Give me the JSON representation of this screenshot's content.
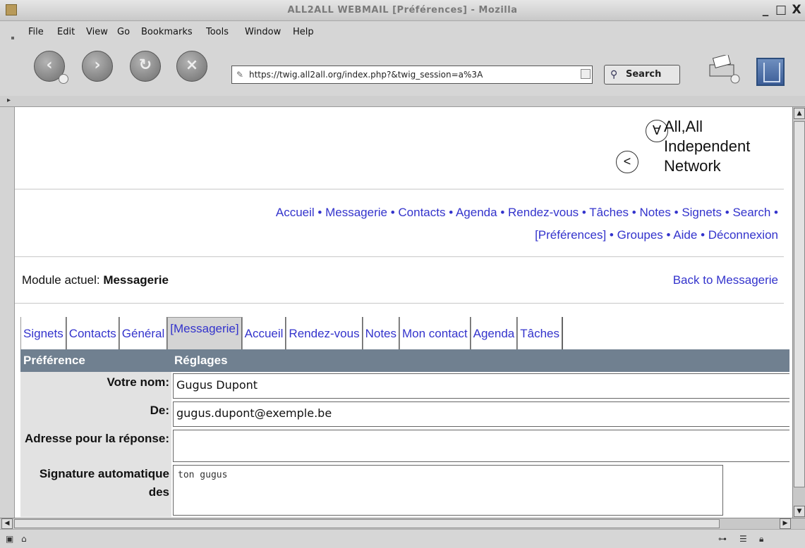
{
  "window": {
    "title": "ALL2ALL WEBMAIL [Préférences] - Mozilla",
    "controls": [
      "_",
      "□",
      "X"
    ]
  },
  "menubar": {
    "items": [
      "File",
      "Edit",
      "View",
      "Go",
      "Bookmarks",
      "Tools",
      "Window",
      "Help"
    ]
  },
  "toolbar": {
    "url": "https://twig.all2all.org/index.php?&twig_session=a%3A",
    "search_label": "Search"
  },
  "logo": {
    "line1": "All,All",
    "line2": "Independent",
    "line3": "Network",
    "glyph_top": "∀",
    "glyph_bottom": "<"
  },
  "nav": {
    "row1": [
      "Accueil",
      "Messagerie",
      "Contacts",
      "Agenda",
      "Rendez-vous",
      "Tâches",
      "Notes",
      "Signets",
      "Search"
    ],
    "row2": [
      "[Préférences]",
      "Groupes",
      "Aide",
      "Déconnexion"
    ],
    "separator": "•"
  },
  "module": {
    "label": "Module actuel:",
    "value": "Messagerie",
    "back_link": "Back to Messagerie"
  },
  "pref_tabs": [
    {
      "label": "Signets",
      "active": false
    },
    {
      "label": "Contacts",
      "active": false
    },
    {
      "label": "Général",
      "active": false
    },
    {
      "label": "[Messagerie]",
      "active": true
    },
    {
      "label": "Accueil",
      "active": false
    },
    {
      "label": "Rendez-vous",
      "active": false
    },
    {
      "label": "Notes",
      "active": false
    },
    {
      "label": "Mon contact",
      "active": false
    },
    {
      "label": "Agenda",
      "active": false
    },
    {
      "label": "Tâches",
      "active": false
    }
  ],
  "table": {
    "header_pref": "Préférence",
    "header_settings": "Réglages",
    "rows": [
      {
        "label": "Votre nom:",
        "value": "Gugus Dupont"
      },
      {
        "label": "De:",
        "value": "gugus.dupont@exemple.be"
      },
      {
        "label": "Adresse pour la réponse:",
        "value": ""
      },
      {
        "label": "Signature automatique des",
        "value": "ton gugus"
      }
    ]
  },
  "icons": {
    "back": "back-arrow-icon",
    "forward": "forward-arrow-icon",
    "reload": "reload-icon",
    "stop": "stop-icon",
    "print": "print-icon",
    "search": "magnifier-icon",
    "lock": "url-lock-icon"
  }
}
